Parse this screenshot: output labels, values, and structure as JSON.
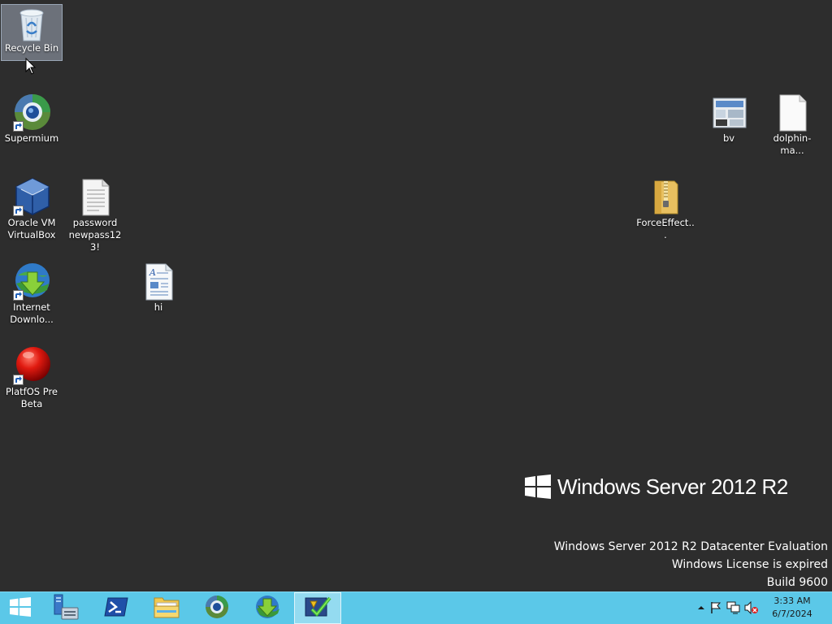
{
  "desktop": {
    "icons": [
      {
        "label": "Recycle Bin",
        "icon": "recycle-bin-icon"
      },
      {
        "label": "Supermium",
        "icon": "supermium-icon"
      },
      {
        "label": "Oracle VM VirtualBox",
        "icon": "virtualbox-icon"
      },
      {
        "label": "password newpass123!",
        "icon": "text-document-icon"
      },
      {
        "label": "Internet Downlo...",
        "icon": "internet-download-manager-icon"
      },
      {
        "label": "hi",
        "icon": "wordpad-document-icon"
      },
      {
        "label": "PlatfOS Pre Beta",
        "icon": "platfos-icon"
      },
      {
        "label": "bv",
        "icon": "image-file-icon"
      },
      {
        "label": "dolphin-ma...",
        "icon": "blank-file-icon"
      },
      {
        "label": "ForceEffect...",
        "icon": "zip-folder-icon"
      }
    ]
  },
  "branding": {
    "text": "Windows Server 2012 R2"
  },
  "watermark": {
    "line1": "Windows Server 2012 R2 Datacenter Evaluation",
    "line2": "Windows License is expired",
    "line3": "Build 9600"
  },
  "taskbar": {
    "buttons": [
      {
        "icon": "start-windows-icon"
      },
      {
        "icon": "server-manager-icon"
      },
      {
        "icon": "powershell-icon"
      },
      {
        "icon": "file-explorer-icon"
      },
      {
        "icon": "supermium-icon"
      },
      {
        "icon": "internet-download-manager-icon"
      },
      {
        "icon": "task-checklist-icon",
        "active": true
      }
    ],
    "tray": {
      "icons": [
        "show-hidden-icons-icon",
        "action-center-flag-icon",
        "network-icon",
        "volume-muted-icon"
      ],
      "time": "3:33 AM",
      "date": "6/7/2024"
    }
  },
  "colors": {
    "desktop_bg": "#2d2d2d",
    "taskbar_bg": "#5bc8e8"
  }
}
